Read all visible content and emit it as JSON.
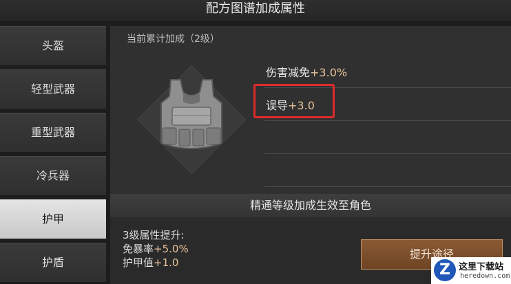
{
  "header": {
    "title": "配方图谱加成属性"
  },
  "sidebar": {
    "items": [
      {
        "label": "头盔"
      },
      {
        "label": "轻型武器"
      },
      {
        "label": "重型武器"
      },
      {
        "label": "冷兵器"
      },
      {
        "label": "护甲",
        "active": true
      },
      {
        "label": "护盾"
      }
    ]
  },
  "main": {
    "section_title": "当前累计加成（2级）",
    "item_icon": "armor-vest-icon",
    "stats": [
      {
        "name": "伤害减免",
        "value": "+3.0%"
      },
      {
        "name": "误导",
        "value": "+3.0",
        "highlighted": true
      },
      {
        "name": "",
        "value": ""
      }
    ]
  },
  "banner": {
    "text": "精通等级加成生效至角色"
  },
  "next_level": {
    "heading": "3级属性提升:",
    "bonuses": [
      {
        "name": "免暴率",
        "value": "+5.0%"
      },
      {
        "name": "护甲值",
        "value": "+1.0"
      }
    ],
    "upgrade_button": "提升途径"
  },
  "watermark": {
    "title": "这里下载站",
    "url": "heredown.com"
  },
  "colors": {
    "accent_value": "#e8c39a",
    "highlight_border": "#e02a2a",
    "button": "#7a4c2a"
  }
}
